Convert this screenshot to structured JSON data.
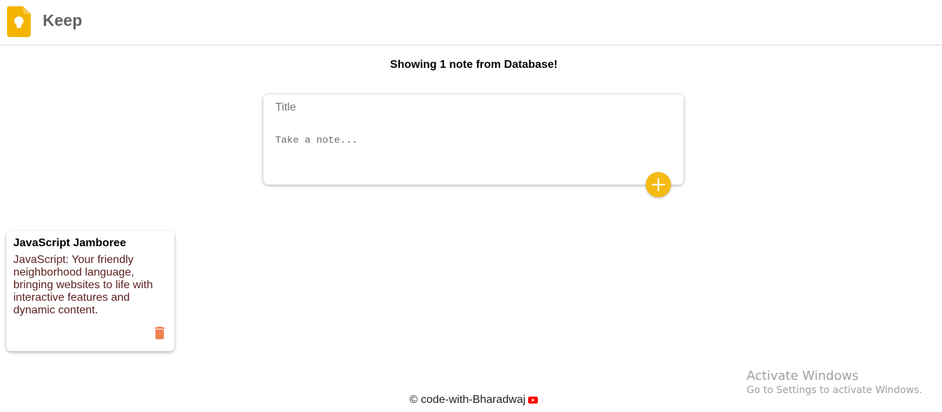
{
  "header": {
    "app_title": "Keep",
    "logo_icon": "keep-bulb-icon"
  },
  "notes_summary": "Showing 1 note from Database!",
  "create_form": {
    "title_placeholder": "Title",
    "content_placeholder": "Take a note...",
    "add_icon": "plus-icon"
  },
  "notes": [
    {
      "title": "JavaScript Jamboree",
      "content": "JavaScript: Your friendly neighborhood language, bringing websites to life with interactive features and dynamic content.",
      "delete_icon": "trash-icon"
    }
  ],
  "footer": {
    "text": "© code-with-Bharadwaj",
    "icon": "youtube-icon"
  },
  "watermark": {
    "line1": "Activate Windows",
    "line2": "Go to Settings to activate Windows."
  },
  "colors": {
    "accent": "#f5ba13",
    "delete": "#ef8354",
    "youtube": "#ff0000"
  }
}
